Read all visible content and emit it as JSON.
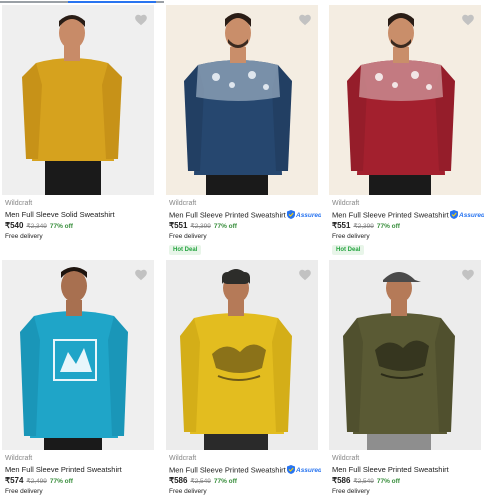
{
  "colors": {
    "accent": "#2874f0",
    "discount": "#388e3c",
    "hot_deal": "#26a541",
    "muted": "#878787"
  },
  "products": [
    {
      "brand": "Wildcraft",
      "title": "Men Full Sleeve Solid Sweatshirt",
      "assured": false,
      "price": "₹540",
      "mrp": "₹2,349",
      "discount": "77% off",
      "delivery": "Free delivery",
      "badge": "",
      "color": "#d6a21e",
      "icon": "heart-icon"
    },
    {
      "brand": "Wildcraft",
      "title": "Men Full Sleeve Printed Sweatshirt",
      "assured": true,
      "price": "₹551",
      "mrp": "₹2,399",
      "discount": "77% off",
      "delivery": "Free delivery",
      "badge": "Hot Deal",
      "color": "#26476f",
      "icon": "heart-icon"
    },
    {
      "brand": "Wildcraft",
      "title": "Men Full Sleeve Printed Sweatshirt",
      "assured": true,
      "price": "₹551",
      "mrp": "₹2,399",
      "discount": "77% off",
      "delivery": "Free delivery",
      "badge": "Hot Deal",
      "color": "#a3202e",
      "icon": "heart-icon"
    },
    {
      "brand": "Wildcraft",
      "title": "Men Full Sleeve Printed Sweatshirt",
      "assured": false,
      "price": "₹574",
      "mrp": "₹2,499",
      "discount": "77% off",
      "delivery": "Free delivery",
      "badge": "",
      "color": "#1fa5c8",
      "icon": "heart-icon"
    },
    {
      "brand": "Wildcraft",
      "title": "Men Full Sleeve Printed Sweatshirt",
      "assured": true,
      "price": "₹586",
      "mrp": "₹2,549",
      "discount": "77% off",
      "delivery": "Free delivery",
      "badge": "",
      "color": "#e3bd1f",
      "icon": "heart-icon"
    },
    {
      "brand": "Wildcraft",
      "title": "Men Full Sleeve Printed Sweatshirt",
      "assured": false,
      "price": "₹586",
      "mrp": "₹2,549",
      "discount": "77% off",
      "delivery": "Free delivery",
      "badge": "",
      "color": "#5a5a34",
      "icon": "heart-icon"
    }
  ]
}
